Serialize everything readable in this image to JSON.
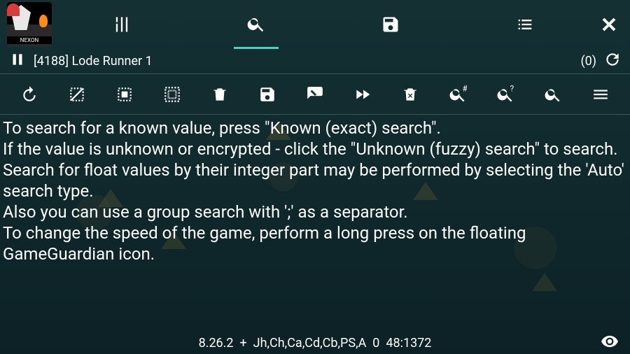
{
  "app_icon_label": "NEXON",
  "tabs": {
    "sliders": "tune-icon",
    "search": "search-icon",
    "save": "save-icon",
    "list": "list-icon",
    "close": "close-icon",
    "active_index": 1
  },
  "process": {
    "title": "[4188] Lode Runner 1",
    "count": "(0)"
  },
  "toolbar": [
    "undo",
    "select-invert",
    "select-all",
    "select-region",
    "delete",
    "save",
    "edit-value",
    "fast-forward",
    "clear",
    "search-hash",
    "search-fuzzy",
    "search",
    "menu"
  ],
  "help": {
    "p1": "To search for a known value, press \"Known (exact) search\".",
    "p2": "If the value is unknown or encrypted - click the \"Unknown (fuzzy) search\" to search.",
    "p3": "Search for float values by their integer part may be performed by selecting the 'Auto' search type.",
    "p4": "Also you can use a group search with ';' as a separator.",
    "p5": "To change the speed of the game, perform a long press on the floating GameGuardian icon."
  },
  "status": {
    "version": "8.26.2",
    "sep1": "+",
    "regions": "Jh,Ch,Ca,Cd,Cb,PS,A",
    "zero": "0",
    "time": "48:1372"
  }
}
